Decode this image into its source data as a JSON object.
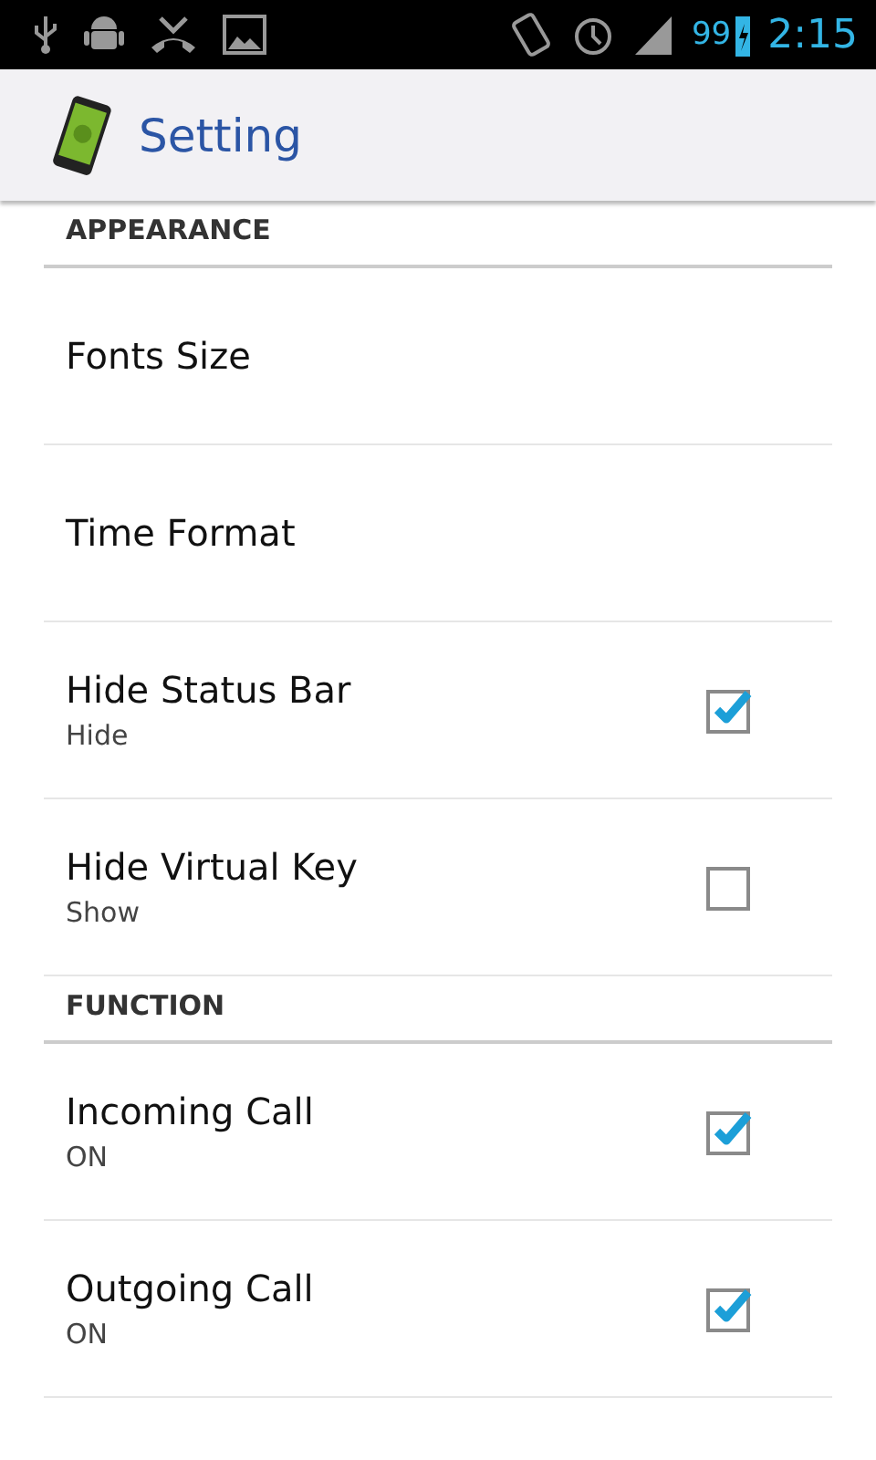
{
  "status_bar": {
    "battery": "99",
    "time": "2:15"
  },
  "action_bar": {
    "title": "Setting"
  },
  "sections": [
    {
      "title": "APPEARANCE",
      "items": [
        {
          "kind": "plain",
          "title": "Fonts Size"
        },
        {
          "kind": "plain",
          "title": "Time Format"
        },
        {
          "kind": "checkbox",
          "title": "Hide Status Bar",
          "summary": "Hide",
          "checked": true
        },
        {
          "kind": "checkbox",
          "title": "Hide Virtual Key",
          "summary": "Show",
          "checked": false
        }
      ]
    },
    {
      "title": "FUNCTION",
      "items": [
        {
          "kind": "checkbox",
          "title": "Incoming Call",
          "summary": "ON",
          "checked": true
        },
        {
          "kind": "checkbox",
          "title": "Outgoing Call",
          "summary": "ON",
          "checked": true
        }
      ]
    }
  ]
}
